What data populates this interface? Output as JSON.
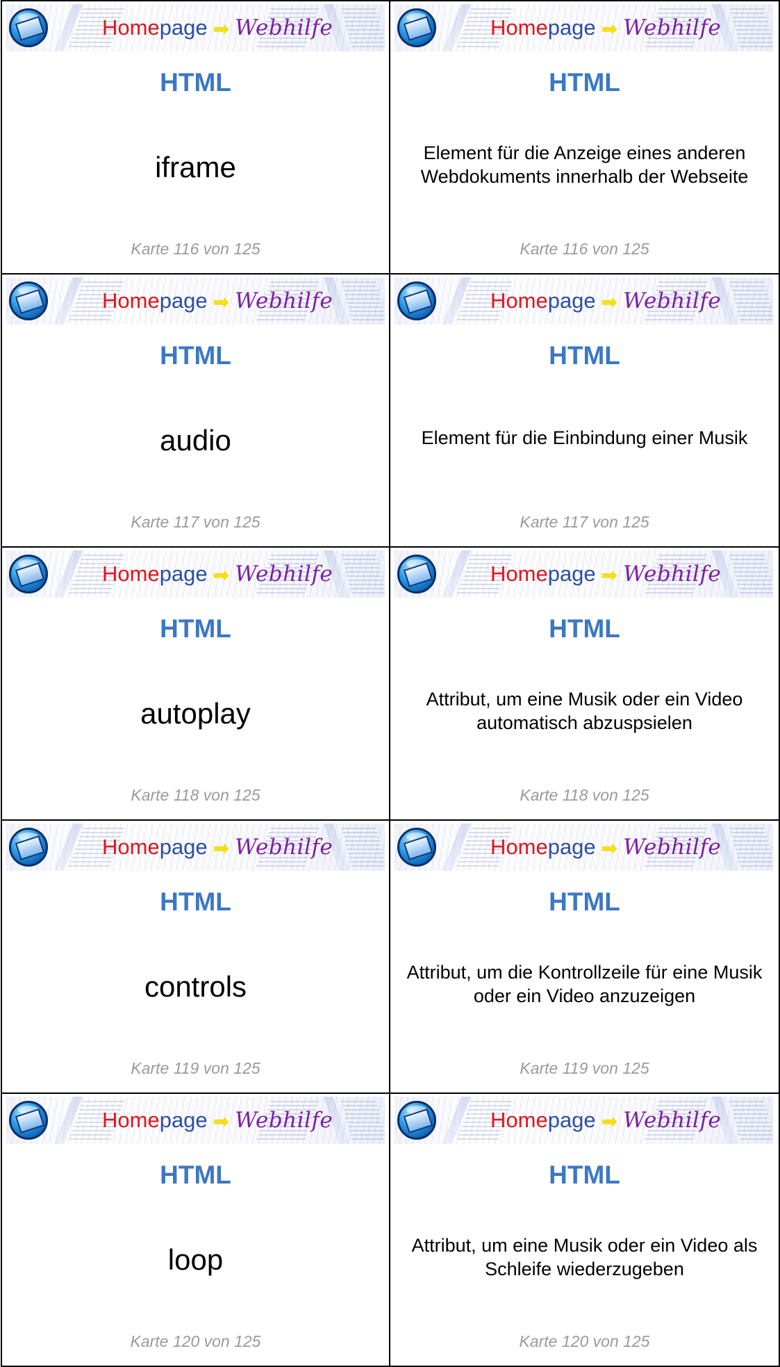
{
  "brand": {
    "home": "Home",
    "page": "page",
    "arrow": "➡",
    "webhilfe": "Webhilfe"
  },
  "cards": [
    {
      "heading": "HTML",
      "term": "iframe",
      "definition": "Element für die Anzeige eines anderen Webdokuments innerhalb der Webseite",
      "footer": "Karte 116 von 125"
    },
    {
      "heading": "HTML",
      "term": "audio",
      "definition": "Element für die Einbindung einer Musik",
      "footer": "Karte 117 von 125"
    },
    {
      "heading": "HTML",
      "term": "autoplay",
      "definition": "Attribut, um eine Musik oder ein Video automatisch abzuspsielen",
      "footer": "Karte 118 von 125"
    },
    {
      "heading": "HTML",
      "term": "controls",
      "definition": "Attribut, um die Kontrollzeile für eine Musik oder ein Video anzuzeigen",
      "footer": "Karte 119 von 125"
    },
    {
      "heading": "HTML",
      "term": "loop",
      "definition": "Attribut, um eine Musik oder ein Video als Schleife wiederzugeben",
      "footer": "Karte 120 von 125"
    }
  ],
  "icons": {
    "logo": "monitor-globe-logo-icon",
    "arrow": "arrow-right-icon"
  },
  "colors": {
    "heading": "#3b78c4",
    "footer": "#9a9a9a",
    "home": "#e3141b",
    "page": "#2b4ea5",
    "webhilfe": "#7d1fa0",
    "arrow": "#f2e11a"
  }
}
